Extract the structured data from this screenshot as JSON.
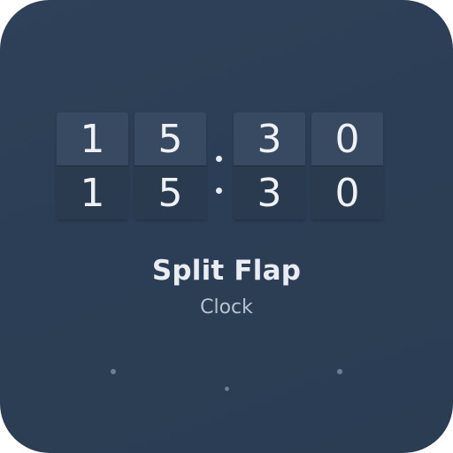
{
  "app": {
    "title": "Split Flap",
    "subtitle": "Clock"
  },
  "clock": {
    "digits": [
      "1",
      "5",
      "3",
      "0"
    ],
    "separator": "."
  },
  "colors": {
    "background": "#2d3f55",
    "flap_top": "#374a62",
    "flap_bottom": "#2a3b50",
    "digit": "#eef2f7",
    "title": "#e8edf3",
    "subtitle": "#b7c3d1"
  }
}
